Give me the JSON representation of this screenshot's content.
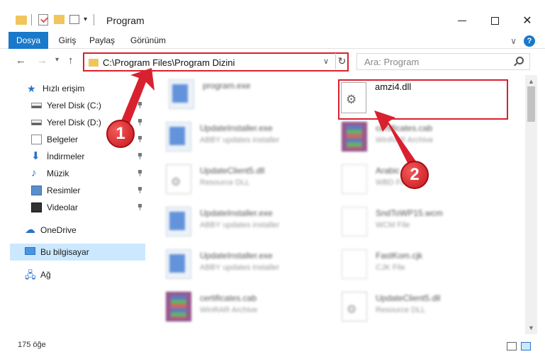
{
  "window": {
    "title": "Program"
  },
  "ribbon": {
    "tabs": [
      {
        "label": "Dosya"
      },
      {
        "label": "Giriş"
      },
      {
        "label": "Paylaş"
      },
      {
        "label": "Görünüm"
      }
    ]
  },
  "navigation": {
    "address": "C:\\Program Files\\Program Dizini",
    "search_placeholder": "Ara: Program"
  },
  "sidebar": {
    "items": [
      {
        "label": "Hızlı erişim",
        "icon": "star-icon"
      },
      {
        "label": "Yerel Disk (C:)",
        "icon": "drive-icon",
        "pinned": true
      },
      {
        "label": "Yerel Disk (D:)",
        "icon": "drive-icon",
        "pinned": true
      },
      {
        "label": "Belgeler",
        "icon": "documents-icon",
        "pinned": true
      },
      {
        "label": "İndirmeler",
        "icon": "download-icon",
        "pinned": true
      },
      {
        "label": "Müzik",
        "icon": "music-icon",
        "pinned": true
      },
      {
        "label": "Resimler",
        "icon": "pictures-icon",
        "pinned": true
      },
      {
        "label": "Videolar",
        "icon": "videos-icon",
        "pinned": true
      },
      {
        "label": "OneDrive",
        "icon": "cloud-icon"
      },
      {
        "label": "Bu bilgisayar",
        "icon": "computer-icon",
        "selected": true
      },
      {
        "label": "Ağ",
        "icon": "network-icon"
      }
    ]
  },
  "files": [
    {
      "name": "program.exe",
      "desc": "",
      "type": "exe"
    },
    {
      "name": "amzi4.dll",
      "desc": "",
      "type": "dll",
      "highlighted": true
    },
    {
      "name": "UpdateInstaller.exe",
      "desc": "ABBY updates installer",
      "type": "exe"
    },
    {
      "name": "certificates.cab",
      "desc": "WinRAR Archive",
      "type": "rar"
    },
    {
      "name": "UpdateClient5.dll",
      "desc": "Resource DLL",
      "type": "dll"
    },
    {
      "name": "Arabic",
      "desc": "WBD File",
      "type": "blank"
    },
    {
      "name": "UpdateInstaller.exe",
      "desc": "ABBY updates installer",
      "type": "exe"
    },
    {
      "name": "SndToWP15.wcm",
      "desc": "WCM File",
      "type": "blank"
    },
    {
      "name": "UpdateInstaller.exe",
      "desc": "ABBY updates installer",
      "type": "exe"
    },
    {
      "name": "FastKom.cjk",
      "desc": "CJK File",
      "type": "blank"
    },
    {
      "name": "certificates.cab",
      "desc": "WinRAR Archive",
      "type": "rar"
    },
    {
      "name": "UpdateClient5.dll",
      "desc": "Resource DLL",
      "type": "dll"
    }
  ],
  "annotations": {
    "step1": "1",
    "step2": "2"
  },
  "status": {
    "item_count": "175 öğe"
  },
  "colors": {
    "accent": "#1979ca",
    "highlight": "#d9202e",
    "selection": "#cce8ff"
  }
}
